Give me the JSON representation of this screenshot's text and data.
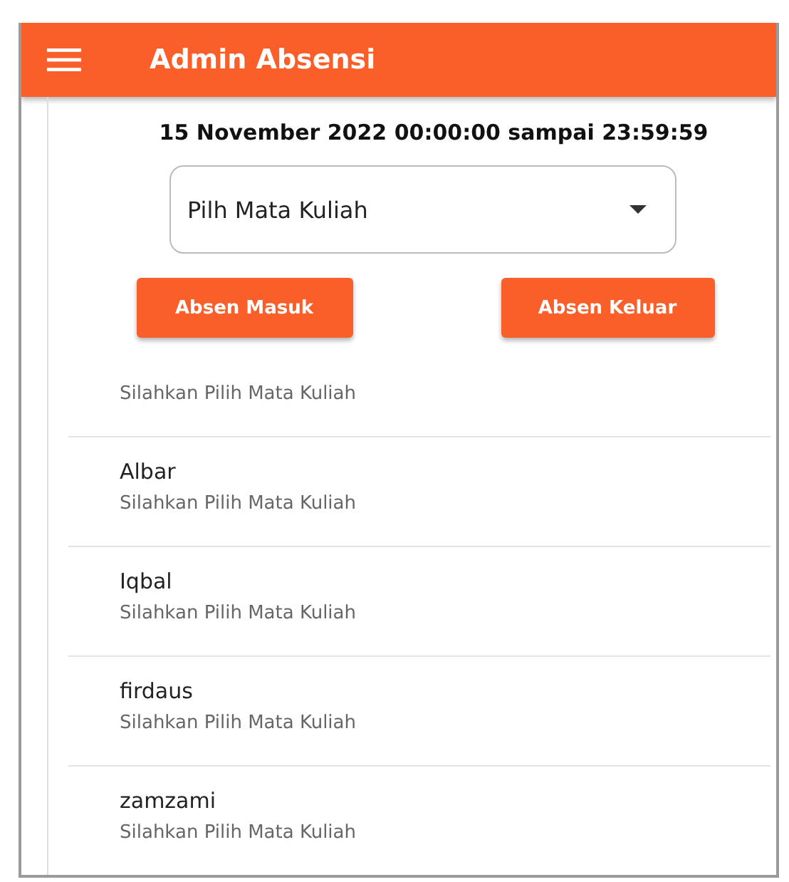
{
  "app_bar": {
    "title": "Admin Absensi"
  },
  "date_range": "15 November 2022 00:00:00 sampai 23:59:59",
  "dropdown": {
    "value": "Pilh Mata Kuliah"
  },
  "buttons": [
    "Absen Masuk",
    "Absen Keluar"
  ],
  "list": [
    {
      "subtitle": "Silahkan Pilih Mata Kuliah"
    },
    {
      "name": "Albar",
      "subtitle": "Silahkan Pilih Mata Kuliah"
    },
    {
      "name": "Iqbal",
      "subtitle": "Silahkan Pilih Mata Kuliah"
    },
    {
      "name": "firdaus",
      "subtitle": "Silahkan Pilih Mata Kuliah"
    },
    {
      "name": "zamzami",
      "subtitle": "Silahkan Pilih Mata Kuliah"
    }
  ]
}
